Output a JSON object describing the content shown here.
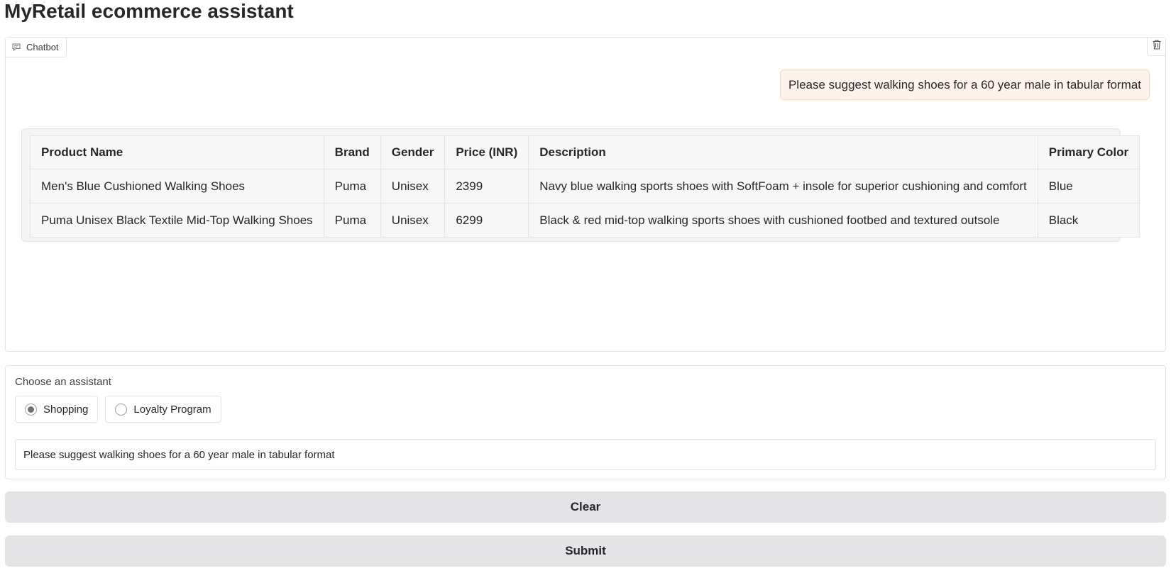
{
  "app": {
    "title": "MyRetail ecommerce assistant"
  },
  "chatbot": {
    "label": "Chatbot",
    "label_icon": "chat-icon",
    "clear_icon": "trash-icon",
    "user_message": "Please suggest walking shoes for a 60 year male in tabular format",
    "bot_table": {
      "headers": [
        "Product Name",
        "Brand",
        "Gender",
        "Price (INR)",
        "Description",
        "Primary Color"
      ],
      "rows": [
        [
          "Men's Blue Cushioned Walking Shoes",
          "Puma",
          "Unisex",
          "2399",
          "Navy blue walking sports shoes with SoftFoam + insole for superior cushioning and comfort",
          "Blue"
        ],
        [
          "Puma Unisex Black Textile Mid-Top Walking Shoes",
          "Puma",
          "Unisex",
          "6299",
          "Black & red mid-top walking sports shoes with cushioned footbed and textured outsole",
          "Black"
        ]
      ]
    }
  },
  "assistant_selector": {
    "label": "Choose an assistant",
    "options": [
      {
        "label": "Shopping",
        "selected": true
      },
      {
        "label": "Loyalty Program",
        "selected": false
      }
    ]
  },
  "input": {
    "value": "Please suggest walking shoes for a 60 year male in tabular format"
  },
  "buttons": {
    "clear_label": "Clear",
    "submit_label": "Submit"
  }
}
